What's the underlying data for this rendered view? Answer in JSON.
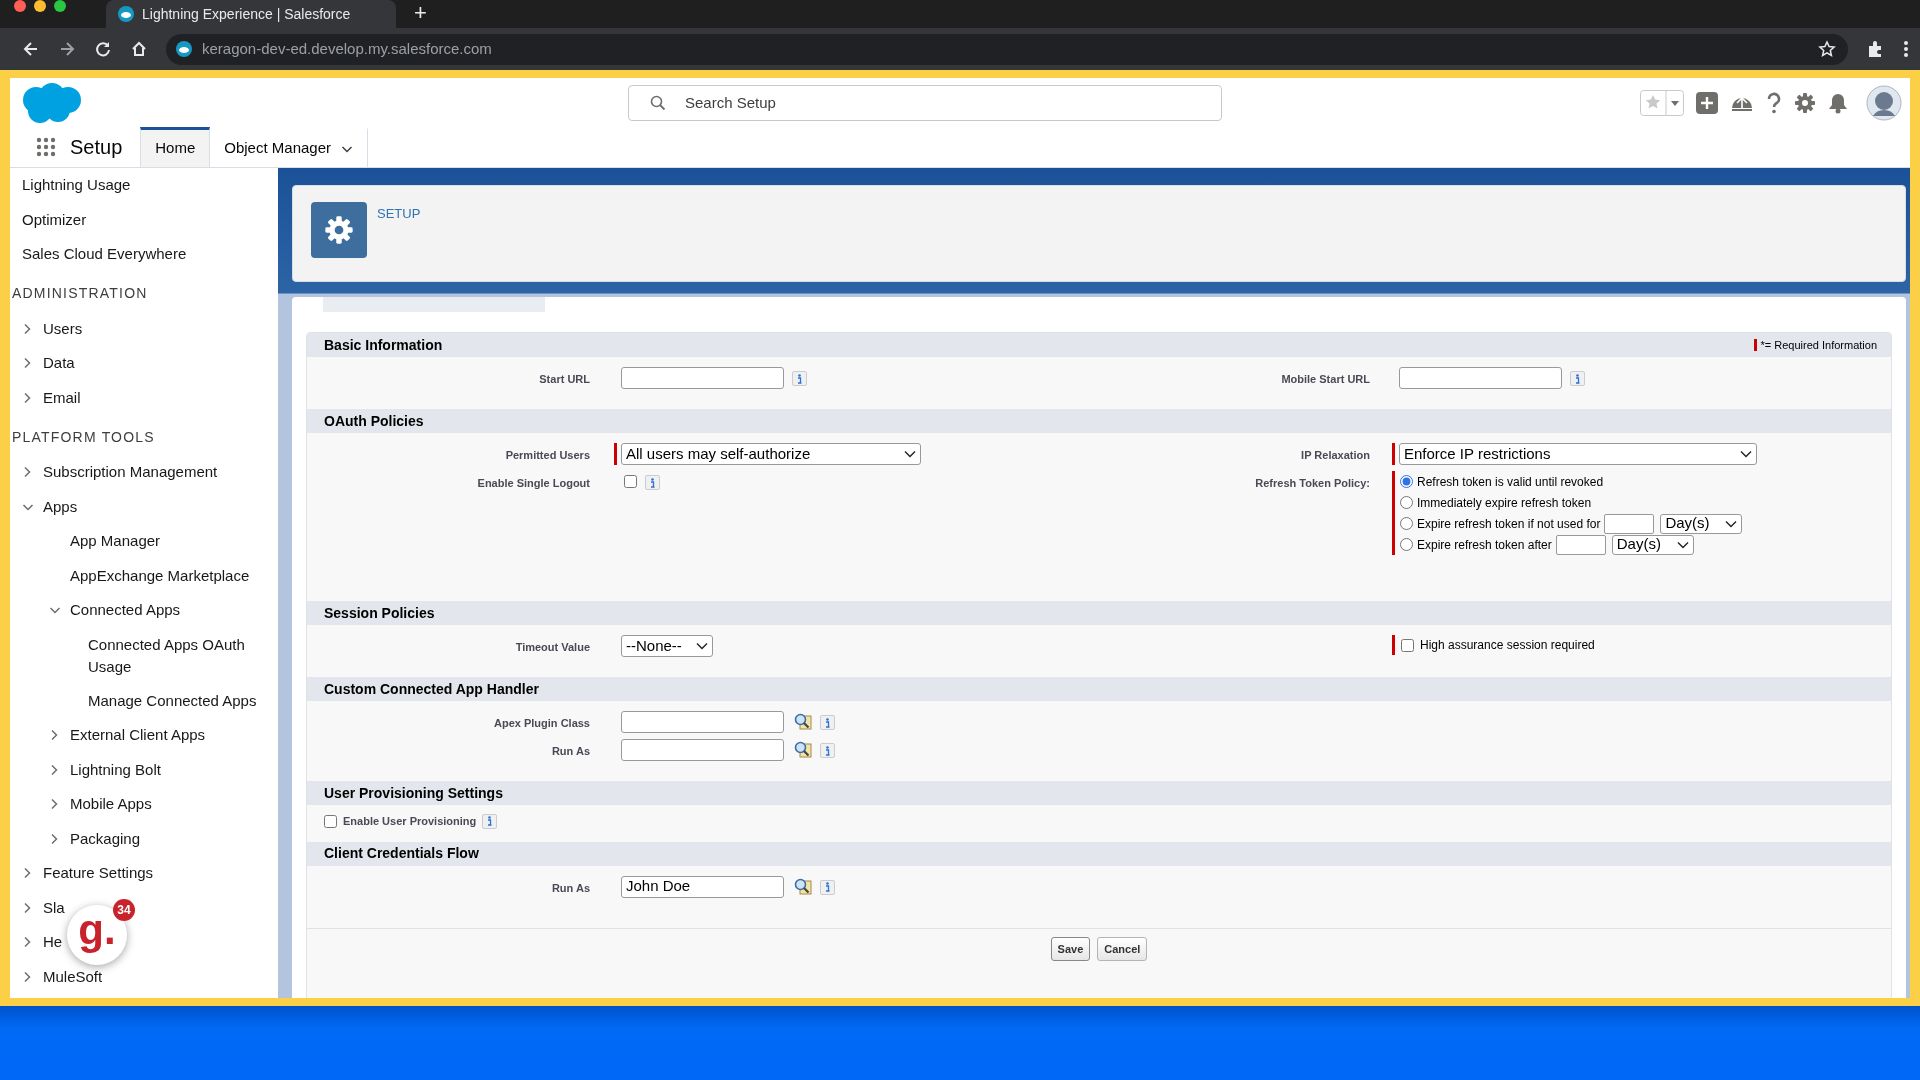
{
  "browser": {
    "tab_title": "Lightning Experience | Salesforce",
    "new_tab": "+",
    "url": "keragon-dev-ed.develop.my.salesforce.com"
  },
  "header": {
    "search_placeholder": "Search Setup"
  },
  "nav": {
    "app_name": "Setup",
    "tabs": [
      {
        "label": "Home",
        "selected": true,
        "dropdown": false
      },
      {
        "label": "Object Manager",
        "selected": false,
        "dropdown": true
      }
    ]
  },
  "sidebar": {
    "items": [
      {
        "kind": "link",
        "label": "Lightning Usage"
      },
      {
        "kind": "link",
        "label": "Optimizer"
      },
      {
        "kind": "link",
        "label": "Sales Cloud Everywhere"
      },
      {
        "kind": "heading",
        "label": "ADMINISTRATION"
      },
      {
        "kind": "node",
        "label": "Users",
        "expanded": false
      },
      {
        "kind": "node",
        "label": "Data",
        "expanded": false
      },
      {
        "kind": "node",
        "label": "Email",
        "expanded": false
      },
      {
        "kind": "heading",
        "label": "PLATFORM TOOLS"
      },
      {
        "kind": "node",
        "label": "Subscription Management",
        "expanded": false
      },
      {
        "kind": "node",
        "label": "Apps",
        "expanded": true,
        "children": [
          {
            "kind": "link",
            "label": "App Manager"
          },
          {
            "kind": "link",
            "label": "AppExchange Marketplace"
          },
          {
            "kind": "node",
            "label": "Connected Apps",
            "expanded": true,
            "children": [
              {
                "kind": "link",
                "label": "Connected Apps OAuth Usage"
              },
              {
                "kind": "link",
                "label": "Manage Connected Apps"
              }
            ]
          },
          {
            "kind": "node",
            "label": "External Client Apps",
            "expanded": false
          },
          {
            "kind": "node",
            "label": "Lightning Bolt",
            "expanded": false
          },
          {
            "kind": "node",
            "label": "Mobile Apps",
            "expanded": false
          },
          {
            "kind": "node",
            "label": "Packaging",
            "expanded": false
          }
        ]
      },
      {
        "kind": "node",
        "label": "Feature Settings",
        "expanded": false
      },
      {
        "kind": "node",
        "label": "Sla",
        "expanded": false
      },
      {
        "kind": "node",
        "label": "He",
        "expanded": false
      },
      {
        "kind": "node",
        "label": "MuleSoft",
        "expanded": false
      }
    ]
  },
  "page_header": {
    "title": "SETUP"
  },
  "form": {
    "required_legend": "*= Required Information",
    "sections": [
      {
        "title": "Basic Information",
        "left": [
          {
            "kind": "text",
            "label": "Start URL",
            "info": true
          }
        ],
        "right": [
          {
            "kind": "text",
            "label": "Mobile Start URL",
            "info": true
          }
        ]
      },
      {
        "title": "OAuth Policies",
        "left": [
          {
            "kind": "select",
            "label": "Permitted Users",
            "value": "All users may self-authorize",
            "required": true
          },
          {
            "kind": "checkbox",
            "label": "Enable Single Logout",
            "checked": false,
            "info": true
          }
        ],
        "right": [
          {
            "kind": "select",
            "label": "IP Relaxation",
            "value": "Enforce IP restrictions",
            "required": true
          },
          {
            "kind": "radios",
            "label": "Refresh Token Policy:",
            "required": true,
            "options": [
              {
                "label": "Refresh token is valid until revoked",
                "selected": true
              },
              {
                "label": "Immediately expire refresh token",
                "selected": false
              },
              {
                "label": "Expire refresh token if not used for",
                "selected": false,
                "unit": "Day(s)"
              },
              {
                "label": "Expire refresh token after",
                "selected": false,
                "unit": "Day(s)"
              }
            ]
          }
        ]
      },
      {
        "title": "Session Policies",
        "left": [
          {
            "kind": "select",
            "label": "Timeout Value",
            "value": "--None--"
          }
        ],
        "right": [
          {
            "kind": "check_option",
            "text": "High assurance session required",
            "checked": false,
            "required": true
          }
        ]
      },
      {
        "title": "Custom Connected App Handler",
        "left": [
          {
            "kind": "text",
            "label": "Apex Plugin Class",
            "info": true,
            "lookup": true
          },
          {
            "kind": "text",
            "label": "Run As",
            "info": true,
            "lookup": true
          }
        ]
      },
      {
        "title": "User Provisioning Settings",
        "left": [
          {
            "kind": "check_label",
            "label": "Enable User Provisioning",
            "checked": false,
            "info": true
          }
        ]
      },
      {
        "title": "Client Credentials Flow",
        "left": [
          {
            "kind": "text",
            "label": "Run As",
            "value": "John Doe",
            "info": true,
            "lookup": true
          }
        ]
      }
    ],
    "buttons": [
      {
        "label": "Save",
        "primary": true
      },
      {
        "label": "Cancel",
        "primary": false
      }
    ]
  },
  "widget": {
    "logo": "g.",
    "badge": "34"
  }
}
